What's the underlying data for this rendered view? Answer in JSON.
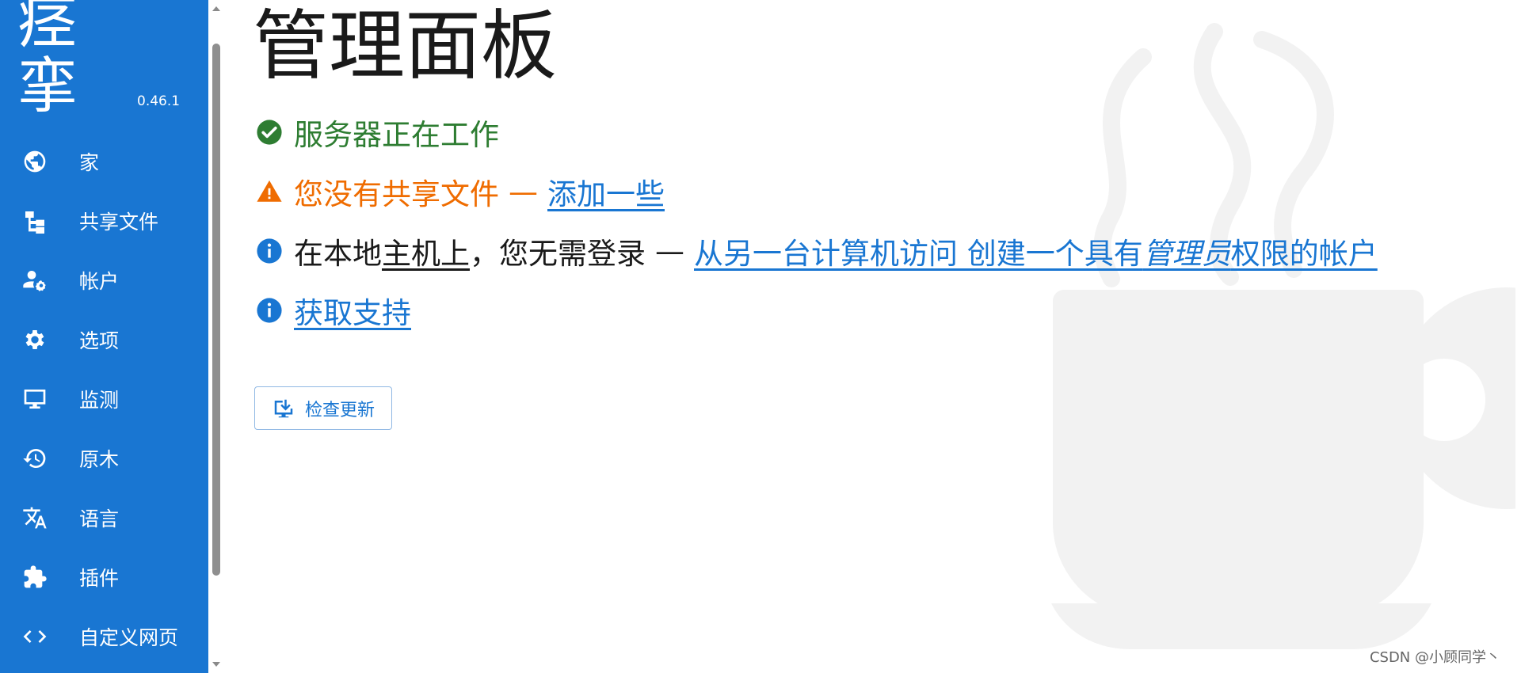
{
  "brand": {
    "name": "痉挛",
    "version": "0.46.1"
  },
  "sidebar": {
    "items": [
      {
        "label": "家",
        "icon": "globe-icon"
      },
      {
        "label": "共享文件",
        "icon": "file-tree-icon"
      },
      {
        "label": "帐户",
        "icon": "account-cog-icon"
      },
      {
        "label": "选项",
        "icon": "gear-icon"
      },
      {
        "label": "监测",
        "icon": "monitor-icon"
      },
      {
        "label": "原木",
        "icon": "history-icon"
      },
      {
        "label": "语言",
        "icon": "translate-icon"
      },
      {
        "label": "插件",
        "icon": "puzzle-icon"
      },
      {
        "label": "自定义网页",
        "icon": "code-icon"
      }
    ]
  },
  "main": {
    "title": "管理面板",
    "status": {
      "server": "服务器正在工作",
      "no_shares": "您没有共享文件",
      "add_some": "添加一些",
      "local_1": "在本地",
      "local_host": "主机上",
      "local_2": "，您无需登录",
      "remote_access": "从另一台计算机访问 创建一个具有",
      "admin_em": "管理员",
      "admin_tail": "权限的帐户",
      "support": "获取支持",
      "dash": "—"
    },
    "check_update": "检查更新"
  },
  "watermark": "CSDN @小顾同学丶",
  "colors": {
    "sidebar_bg": "#1976d2",
    "success": "#2e7d32",
    "warning": "#ef6c00",
    "link": "#1976d2"
  }
}
